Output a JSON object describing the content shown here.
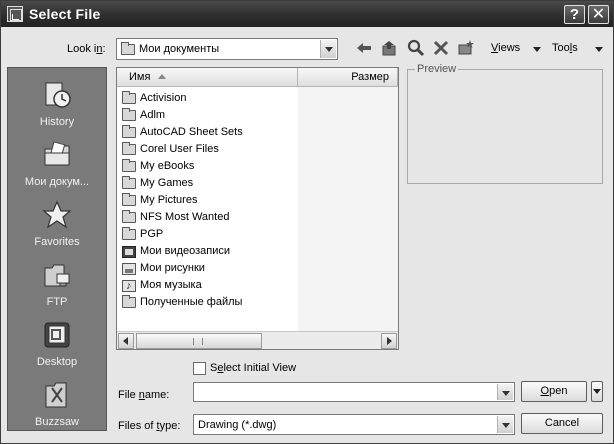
{
  "window": {
    "title": "Select File"
  },
  "titlebar": {
    "help": "?",
    "close": "✕"
  },
  "toolbar": {
    "look_in_label": "Look in:",
    "look_in_value": "Мои документы",
    "views_label": "Views",
    "tools_label": "Tools"
  },
  "places": [
    {
      "label": "History",
      "icon": "history-icon"
    },
    {
      "label": "Мои докум...",
      "icon": "my-documents-icon"
    },
    {
      "label": "Favorites",
      "icon": "favorites-star-icon"
    },
    {
      "label": "FTP",
      "icon": "ftp-icon"
    },
    {
      "label": "Desktop",
      "icon": "desktop-icon"
    },
    {
      "label": "Buzzsaw",
      "icon": "buzzsaw-icon"
    }
  ],
  "file_list": {
    "columns": {
      "name": "Имя",
      "size": "Размер"
    },
    "items": [
      {
        "name": "Activision",
        "icon": "folder-icon"
      },
      {
        "name": "Adlm",
        "icon": "folder-icon"
      },
      {
        "name": "AutoCAD Sheet Sets",
        "icon": "folder-icon"
      },
      {
        "name": "Corel User Files",
        "icon": "folder-icon"
      },
      {
        "name": "My eBooks",
        "icon": "folder-icon"
      },
      {
        "name": "My Games",
        "icon": "folder-icon"
      },
      {
        "name": "My Pictures",
        "icon": "folder-icon"
      },
      {
        "name": "NFS Most Wanted",
        "icon": "folder-icon"
      },
      {
        "name": "PGP",
        "icon": "folder-icon"
      },
      {
        "name": "Мои видеозаписи",
        "icon": "video-folder-icon"
      },
      {
        "name": "Мои рисунки",
        "icon": "pictures-folder-icon"
      },
      {
        "name": "Моя музыка",
        "icon": "music-folder-icon"
      },
      {
        "name": "Полученные файлы",
        "icon": "folder-icon"
      }
    ]
  },
  "preview": {
    "label": "Preview"
  },
  "options": {
    "select_initial_view": "Select Initial View",
    "select_initial_view_checked": false
  },
  "file_name": {
    "label": "File name:",
    "value": ""
  },
  "file_type": {
    "label": "Files of type:",
    "value": "Drawing (*.dwg)"
  },
  "buttons": {
    "open": "Open",
    "cancel": "Cancel"
  }
}
